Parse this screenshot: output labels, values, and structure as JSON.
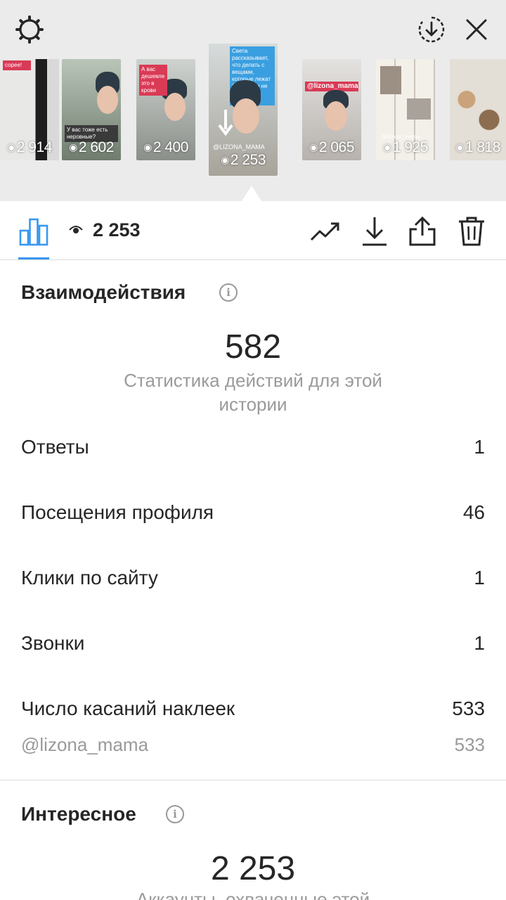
{
  "header": {
    "icons": [
      "settings-icon",
      "download-circle-icon",
      "close-icon"
    ]
  },
  "stories": [
    {
      "views": "2 914",
      "tag": "сорее!"
    },
    {
      "views": "2 602",
      "tag": "У вас тоже есть неровные?"
    },
    {
      "views": "2 400",
      "tag": "А вас дешевле это в крови"
    },
    {
      "views": "2 253",
      "tag": "Света рассказывает, что делать с вещами, которые лежат без дела и не приносят пользу",
      "watermark": "@LIZONA_MAMA",
      "selected": true
    },
    {
      "views": "2 065",
      "tag": "@lizona_mama"
    },
    {
      "views": "1 925",
      "tag": "@lizona_mama"
    },
    {
      "views": "1 818",
      "tag": ""
    }
  ],
  "toolbar": {
    "views": "2 253",
    "accent_color": "#3897f0"
  },
  "interactions": {
    "title": "Взаимодействия",
    "info_glyph": "i",
    "total": "582",
    "subtitle": "Статистика действий для этой истории",
    "rows": [
      {
        "label": "Ответы",
        "value": "1"
      },
      {
        "label": "Посещения профиля",
        "value": "46"
      },
      {
        "label": "Клики по сайту",
        "value": "1"
      },
      {
        "label": "Звонки",
        "value": "1"
      },
      {
        "label": "Число касаний наклеек",
        "value": "533"
      }
    ],
    "sub_row": {
      "label": "@lizona_mama",
      "value": "533"
    }
  },
  "discovery": {
    "title": "Интересное",
    "info_glyph": "i",
    "total": "2 253",
    "subtitle": "Аккаунты, охваченные этой"
  }
}
